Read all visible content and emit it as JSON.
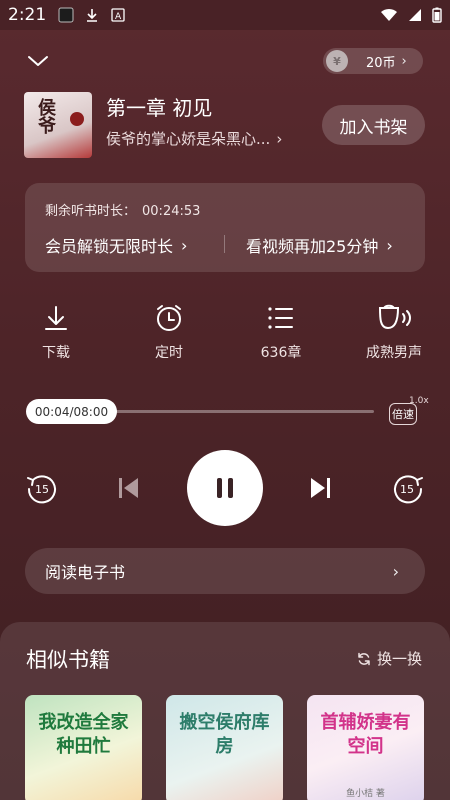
{
  "status_bar": {
    "time": "2:21"
  },
  "header": {
    "coins_label": "20币",
    "coin_symbol": "¥"
  },
  "book": {
    "cover_text": "侯爷",
    "chapter_title": "第一章 初见",
    "book_line": "侯爷的掌心娇是朵黑心...",
    "add_shelf_label": "加入书架"
  },
  "listen_card": {
    "remaining_label": "剩余听书时长：",
    "remaining_value": "00:24:53",
    "vip_link": "会员解锁无限时长",
    "video_link": "看视频再加25分钟"
  },
  "tools": [
    {
      "label": "下载",
      "icon": "download-icon"
    },
    {
      "label": "定时",
      "icon": "alarm-clock-icon"
    },
    {
      "label": "636章",
      "icon": "chapter-list-icon"
    },
    {
      "label": "成熟男声",
      "icon": "voice-icon"
    }
  ],
  "player": {
    "time_display": "00:04/08:00",
    "progress": 0.0,
    "speed_label": "倍速",
    "speed_value": "1.0x",
    "rewind_label": "15",
    "forward_label": "15"
  },
  "read_ebook_label": "阅读电子书",
  "similar": {
    "title": "相似书籍",
    "refresh_label": "换一换",
    "books": [
      {
        "cover_title": "我改造全家种田忙",
        "cover_sub": ""
      },
      {
        "cover_title": "搬空侯府库房",
        "cover_sub": ""
      },
      {
        "cover_title": "首辅娇妻有空间",
        "cover_sub": "鱼小桔 著"
      }
    ]
  },
  "colors": {
    "background": "#4d2428",
    "accent_white": "#ffffff"
  }
}
